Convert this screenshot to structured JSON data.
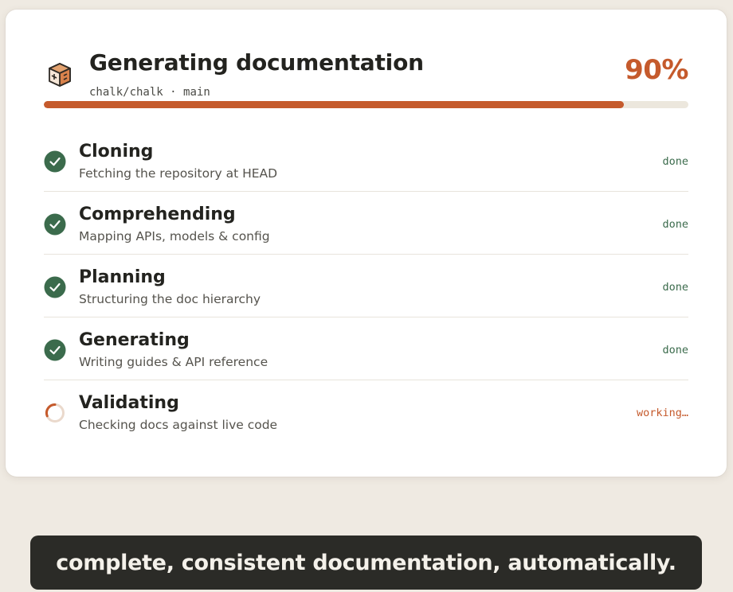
{
  "header": {
    "title": "Generating documentation",
    "repo": "chalk/chalk",
    "separator": "·",
    "branch": "main",
    "percent_label": "90%"
  },
  "progress": {
    "value": 90,
    "fill_color": "#c55a2c",
    "track_color": "#ece7dd"
  },
  "steps": [
    {
      "title": "Cloning",
      "description": "Fetching the repository at HEAD",
      "status": "done",
      "icon": "check-circle-icon"
    },
    {
      "title": "Comprehending",
      "description": "Mapping APIs, models & config",
      "status": "done",
      "icon": "check-circle-icon"
    },
    {
      "title": "Planning",
      "description": "Structuring the doc hierarchy",
      "status": "done",
      "icon": "check-circle-icon"
    },
    {
      "title": "Generating",
      "description": "Writing guides & API reference",
      "status": "done",
      "icon": "check-circle-icon"
    },
    {
      "title": "Validating",
      "description": "Checking docs against live code",
      "status": "working…",
      "icon": "spinner-icon"
    }
  ],
  "caption": {
    "text": "complete, consistent documentation, automatically."
  },
  "colors": {
    "accent": "#c55a2c",
    "done_green": "#3b6b4c",
    "text_dark": "#23231f",
    "background": "#efeae2"
  }
}
